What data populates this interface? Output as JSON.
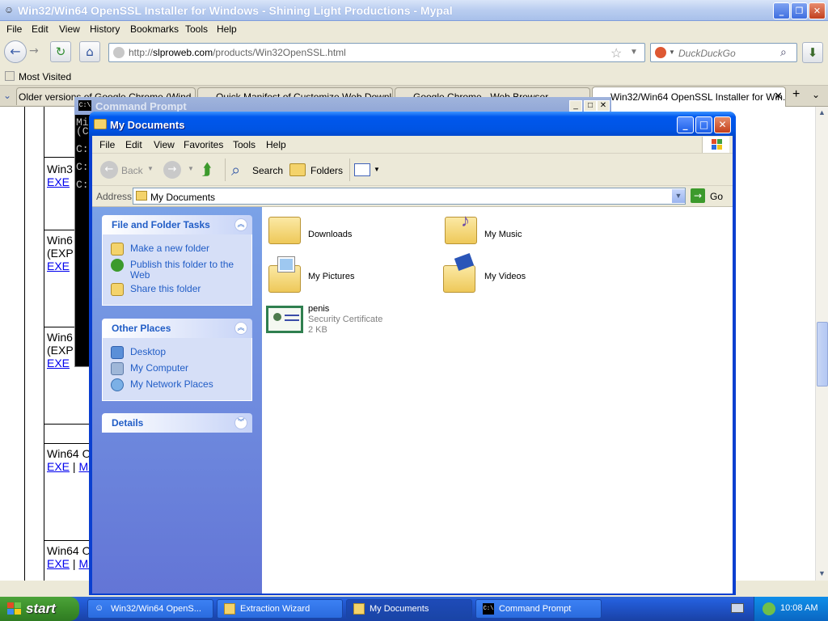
{
  "browser": {
    "title": "Win32/Win64 OpenSSL Installer for Windows - Shining Light Productions - Mypal",
    "menu": [
      "File",
      "Edit",
      "View",
      "History",
      "Bookmarks",
      "Tools",
      "Help"
    ],
    "url_domain": "slproweb.com",
    "url_prefix": "http://",
    "url_path": "/products/Win32OpenSSL.html",
    "search_placeholder": "DuckDuckGo",
    "bookmark": "Most Visited",
    "tabs": [
      "Older versions of Google Chrome (Wind...",
      "Quick Manifest of Customize Web Download...",
      "Google Chrome - Web Browser",
      "Win32/Win64 OpenSSL Installer for Win..."
    ],
    "page_cells": [
      {
        "t1": "Win3",
        "t2": "",
        "link": "EXE",
        "extra": ""
      },
      {
        "t1": "Win6",
        "t2": "(EXP",
        "link": "EXE",
        "extra": ""
      },
      {
        "t1": "Win6",
        "t2": "(EXP",
        "link": "EXE",
        "extra": ""
      },
      {
        "t1": "Win64 O",
        "t2": "",
        "link": "EXE",
        "extra": "MS"
      },
      {
        "t1": "Win64 O",
        "t2": "",
        "link": "EXE",
        "extra": "MS"
      }
    ]
  },
  "cmd": {
    "title": "Command Prompt",
    "lines": [
      "Mi",
      "(C",
      "",
      "C:",
      "",
      "C:",
      "",
      "C:"
    ]
  },
  "explorer": {
    "title": "My Documents",
    "menu": [
      "File",
      "Edit",
      "View",
      "Favorites",
      "Tools",
      "Help"
    ],
    "toolbar": {
      "back": "Back",
      "search": "Search",
      "folders": "Folders"
    },
    "address_label": "Address",
    "address_value": "My Documents",
    "go": "Go",
    "tasks": {
      "title": "File and Folder Tasks",
      "items": [
        "Make a new folder",
        "Publish this folder to the Web",
        "Share this folder"
      ]
    },
    "places": {
      "title": "Other Places",
      "items": [
        "Desktop",
        "My Computer",
        "My Network Places"
      ]
    },
    "details": {
      "title": "Details"
    },
    "items": [
      {
        "name": "Downloads",
        "sub1": "",
        "sub2": ""
      },
      {
        "name": "My Music",
        "sub1": "",
        "sub2": ""
      },
      {
        "name": "My Pictures",
        "sub1": "",
        "sub2": ""
      },
      {
        "name": "My Videos",
        "sub1": "",
        "sub2": ""
      },
      {
        "name": "penis",
        "sub1": "Security Certificate",
        "sub2": "2 KB"
      }
    ]
  },
  "taskbar": {
    "start": "start",
    "buttons": [
      "Win32/Win64 OpenS...",
      "Extraction Wizard",
      "My Documents",
      "Command Prompt"
    ],
    "clock": "10:08 AM"
  },
  "colors": {
    "xp_blue": "#0054e3",
    "task_link": "#215dc6",
    "start_green": "#3c8f2b"
  }
}
